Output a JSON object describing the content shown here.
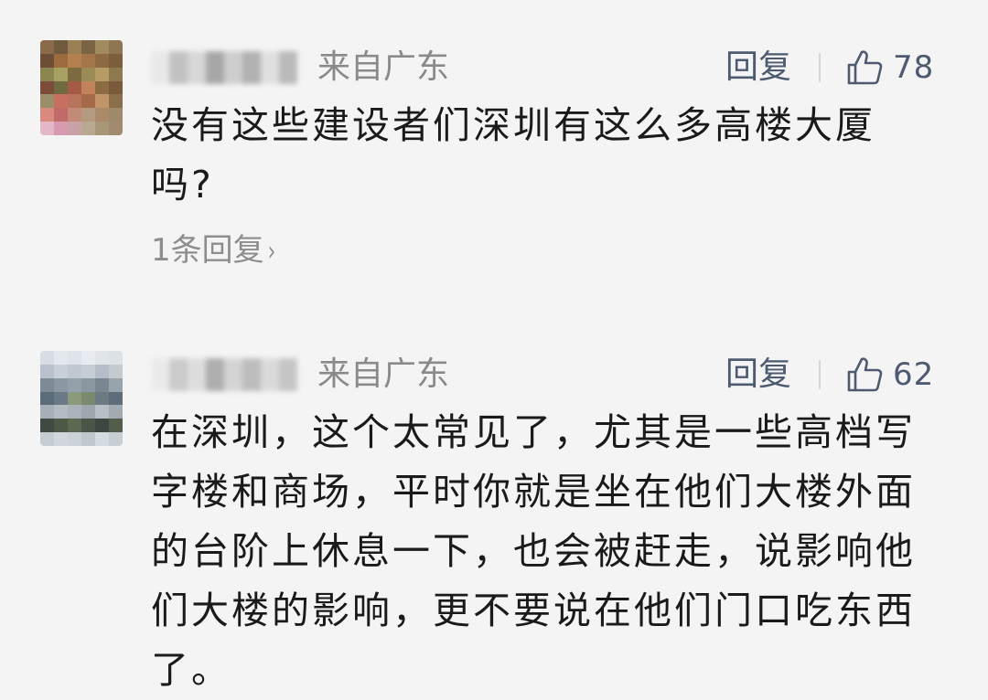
{
  "comments": [
    {
      "location": "来自广东",
      "reply_label": "回复",
      "likes": "78",
      "text": "没有这些建设者们深圳有这么多高楼大厦吗?",
      "replies_link": "1条回复",
      "replies_chevron": "›",
      "avatar_colors": [
        "#8a6a4a",
        "#6f5a3e",
        "#9b7f55",
        "#7a6444",
        "#a08a5e",
        "#8f7652",
        "#6b4e35",
        "#9e6b3f",
        "#b48050",
        "#a3764a",
        "#8e6a43",
        "#7d5e3c",
        "#8b8550",
        "#a6a062",
        "#7c6b3f",
        "#9a8a55",
        "#b59c64",
        "#8c7a4e",
        "#7c4b3a",
        "#6f6a3f",
        "#a45a44",
        "#c0835a",
        "#8d6b42",
        "#7a5a3a",
        "#9a8f6a",
        "#c77060",
        "#b9735d",
        "#a56a48",
        "#c2946a",
        "#8a6f4a",
        "#d98a7e",
        "#c06a6a",
        "#c48a78",
        "#b49a80",
        "#aa8a68",
        "#9e8a6a",
        "#e2b8c8",
        "#d89ab0",
        "#c9a2a8",
        "#b8a890",
        "#a89878",
        "#a08a70"
      ]
    },
    {
      "location": "来自广东",
      "reply_label": "回复",
      "likes": "62",
      "text": "在深圳，这个太常见了，尤其是一些高档写字楼和商场，平时你就是坐在他们大楼外面的台阶上休息一下，也会被赶走，说影响他们大楼的影响，更不要说在他们门口吃东西了。",
      "avatar_colors": [
        "#d8dde3",
        "#e4e8ec",
        "#dfe4ea",
        "#e8ebef",
        "#e1e5ea",
        "#dce1e6",
        "#b9c2cc",
        "#c9d0d8",
        "#bfc7d0",
        "#c6cdd5",
        "#b5bec8",
        "#c3cad2",
        "#7e8a96",
        "#8b97a2",
        "#94a0aa",
        "#8a96a0",
        "#7a8692",
        "#98a3ac",
        "#5c6b78",
        "#6a7a86",
        "#8a9a7a",
        "#7a8a70",
        "#6c7a84",
        "#5f6d7a",
        "#a7b0b8",
        "#b3bcc3",
        "#aab3ba",
        "#9ea7ae",
        "#b8bfc5",
        "#a2abb2",
        "#3f4a42",
        "#4d5847",
        "#5e6850",
        "#4a5448",
        "#3d4640",
        "#535d4c",
        "#c5cdd3",
        "#d1d7dc",
        "#ccd3d8",
        "#c0c8ce",
        "#d5dbe0",
        "#c8cfd4"
      ]
    }
  ],
  "name_blur_colors": [
    [
      "#e7e7e7",
      "#b9b9b9",
      "#d2d2d2",
      "#9a9a9a",
      "#c8c8c8",
      "#a6a6a6",
      "#dcdcdc",
      "#b0b0b0"
    ],
    [
      "#e9e9e9",
      "#c4c4c4",
      "#dadada",
      "#a2a2a2",
      "#cfcfcf",
      "#b3b3b3",
      "#d6d6d6",
      "#bdbdbd"
    ]
  ]
}
